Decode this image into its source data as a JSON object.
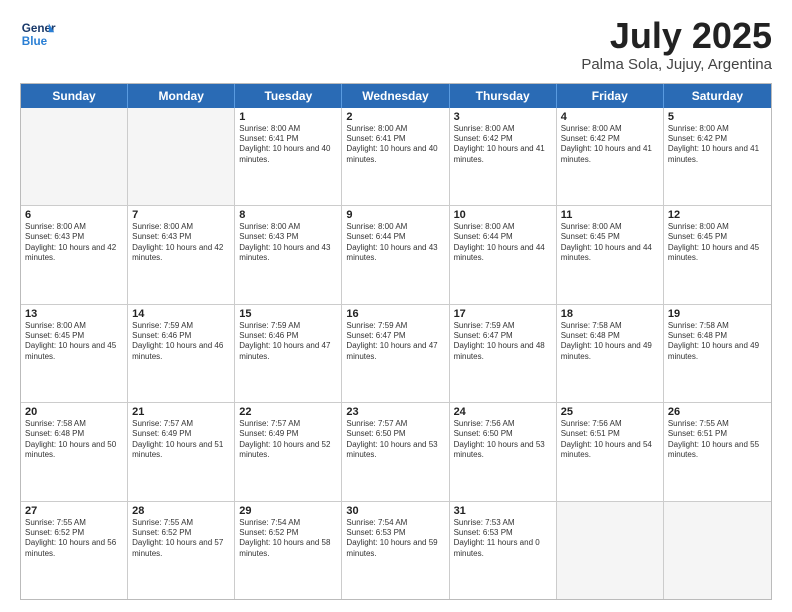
{
  "header": {
    "logo_general": "General",
    "logo_blue": "Blue",
    "month_year": "July 2025",
    "location": "Palma Sola, Jujuy, Argentina"
  },
  "days_of_week": [
    "Sunday",
    "Monday",
    "Tuesday",
    "Wednesday",
    "Thursday",
    "Friday",
    "Saturday"
  ],
  "weeks": [
    [
      {
        "day": "",
        "empty": true
      },
      {
        "day": "",
        "empty": true
      },
      {
        "day": "1",
        "sunrise": "Sunrise: 8:00 AM",
        "sunset": "Sunset: 6:41 PM",
        "daylight": "Daylight: 10 hours and 40 minutes."
      },
      {
        "day": "2",
        "sunrise": "Sunrise: 8:00 AM",
        "sunset": "Sunset: 6:41 PM",
        "daylight": "Daylight: 10 hours and 40 minutes."
      },
      {
        "day": "3",
        "sunrise": "Sunrise: 8:00 AM",
        "sunset": "Sunset: 6:42 PM",
        "daylight": "Daylight: 10 hours and 41 minutes."
      },
      {
        "day": "4",
        "sunrise": "Sunrise: 8:00 AM",
        "sunset": "Sunset: 6:42 PM",
        "daylight": "Daylight: 10 hours and 41 minutes."
      },
      {
        "day": "5",
        "sunrise": "Sunrise: 8:00 AM",
        "sunset": "Sunset: 6:42 PM",
        "daylight": "Daylight: 10 hours and 41 minutes."
      }
    ],
    [
      {
        "day": "6",
        "sunrise": "Sunrise: 8:00 AM",
        "sunset": "Sunset: 6:43 PM",
        "daylight": "Daylight: 10 hours and 42 minutes."
      },
      {
        "day": "7",
        "sunrise": "Sunrise: 8:00 AM",
        "sunset": "Sunset: 6:43 PM",
        "daylight": "Daylight: 10 hours and 42 minutes."
      },
      {
        "day": "8",
        "sunrise": "Sunrise: 8:00 AM",
        "sunset": "Sunset: 6:43 PM",
        "daylight": "Daylight: 10 hours and 43 minutes."
      },
      {
        "day": "9",
        "sunrise": "Sunrise: 8:00 AM",
        "sunset": "Sunset: 6:44 PM",
        "daylight": "Daylight: 10 hours and 43 minutes."
      },
      {
        "day": "10",
        "sunrise": "Sunrise: 8:00 AM",
        "sunset": "Sunset: 6:44 PM",
        "daylight": "Daylight: 10 hours and 44 minutes."
      },
      {
        "day": "11",
        "sunrise": "Sunrise: 8:00 AM",
        "sunset": "Sunset: 6:45 PM",
        "daylight": "Daylight: 10 hours and 44 minutes."
      },
      {
        "day": "12",
        "sunrise": "Sunrise: 8:00 AM",
        "sunset": "Sunset: 6:45 PM",
        "daylight": "Daylight: 10 hours and 45 minutes."
      }
    ],
    [
      {
        "day": "13",
        "sunrise": "Sunrise: 8:00 AM",
        "sunset": "Sunset: 6:45 PM",
        "daylight": "Daylight: 10 hours and 45 minutes."
      },
      {
        "day": "14",
        "sunrise": "Sunrise: 7:59 AM",
        "sunset": "Sunset: 6:46 PM",
        "daylight": "Daylight: 10 hours and 46 minutes."
      },
      {
        "day": "15",
        "sunrise": "Sunrise: 7:59 AM",
        "sunset": "Sunset: 6:46 PM",
        "daylight": "Daylight: 10 hours and 47 minutes."
      },
      {
        "day": "16",
        "sunrise": "Sunrise: 7:59 AM",
        "sunset": "Sunset: 6:47 PM",
        "daylight": "Daylight: 10 hours and 47 minutes."
      },
      {
        "day": "17",
        "sunrise": "Sunrise: 7:59 AM",
        "sunset": "Sunset: 6:47 PM",
        "daylight": "Daylight: 10 hours and 48 minutes."
      },
      {
        "day": "18",
        "sunrise": "Sunrise: 7:58 AM",
        "sunset": "Sunset: 6:48 PM",
        "daylight": "Daylight: 10 hours and 49 minutes."
      },
      {
        "day": "19",
        "sunrise": "Sunrise: 7:58 AM",
        "sunset": "Sunset: 6:48 PM",
        "daylight": "Daylight: 10 hours and 49 minutes."
      }
    ],
    [
      {
        "day": "20",
        "sunrise": "Sunrise: 7:58 AM",
        "sunset": "Sunset: 6:48 PM",
        "daylight": "Daylight: 10 hours and 50 minutes."
      },
      {
        "day": "21",
        "sunrise": "Sunrise: 7:57 AM",
        "sunset": "Sunset: 6:49 PM",
        "daylight": "Daylight: 10 hours and 51 minutes."
      },
      {
        "day": "22",
        "sunrise": "Sunrise: 7:57 AM",
        "sunset": "Sunset: 6:49 PM",
        "daylight": "Daylight: 10 hours and 52 minutes."
      },
      {
        "day": "23",
        "sunrise": "Sunrise: 7:57 AM",
        "sunset": "Sunset: 6:50 PM",
        "daylight": "Daylight: 10 hours and 53 minutes."
      },
      {
        "day": "24",
        "sunrise": "Sunrise: 7:56 AM",
        "sunset": "Sunset: 6:50 PM",
        "daylight": "Daylight: 10 hours and 53 minutes."
      },
      {
        "day": "25",
        "sunrise": "Sunrise: 7:56 AM",
        "sunset": "Sunset: 6:51 PM",
        "daylight": "Daylight: 10 hours and 54 minutes."
      },
      {
        "day": "26",
        "sunrise": "Sunrise: 7:55 AM",
        "sunset": "Sunset: 6:51 PM",
        "daylight": "Daylight: 10 hours and 55 minutes."
      }
    ],
    [
      {
        "day": "27",
        "sunrise": "Sunrise: 7:55 AM",
        "sunset": "Sunset: 6:52 PM",
        "daylight": "Daylight: 10 hours and 56 minutes."
      },
      {
        "day": "28",
        "sunrise": "Sunrise: 7:55 AM",
        "sunset": "Sunset: 6:52 PM",
        "daylight": "Daylight: 10 hours and 57 minutes."
      },
      {
        "day": "29",
        "sunrise": "Sunrise: 7:54 AM",
        "sunset": "Sunset: 6:52 PM",
        "daylight": "Daylight: 10 hours and 58 minutes."
      },
      {
        "day": "30",
        "sunrise": "Sunrise: 7:54 AM",
        "sunset": "Sunset: 6:53 PM",
        "daylight": "Daylight: 10 hours and 59 minutes."
      },
      {
        "day": "31",
        "sunrise": "Sunrise: 7:53 AM",
        "sunset": "Sunset: 6:53 PM",
        "daylight": "Daylight: 11 hours and 0 minutes."
      },
      {
        "day": "",
        "empty": true
      },
      {
        "day": "",
        "empty": true
      }
    ]
  ]
}
